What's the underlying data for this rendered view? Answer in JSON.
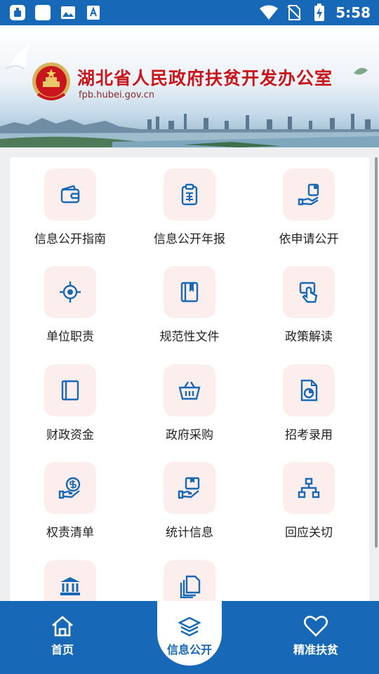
{
  "status_bar": {
    "time": "5:58",
    "left_icons": [
      "app-notification-icon",
      "blank-square-icon",
      "image-icon",
      "text-a-icon"
    ],
    "right_icons": [
      "wifi-icon",
      "no-sim-icon",
      "battery-charging-icon"
    ]
  },
  "banner": {
    "title": "湖北省人民政府扶贫开发办公室",
    "url": "fpb.hubei.gov.cn",
    "emblem": "national-emblem-icon"
  },
  "grid": {
    "items": [
      {
        "label": "信息公开指南",
        "icon": "wallet-icon"
      },
      {
        "label": "信息公开年报",
        "icon": "clipboard-year-icon"
      },
      {
        "label": "依申请公开",
        "icon": "hand-document-icon"
      },
      {
        "label": "单位职责",
        "icon": "target-icon"
      },
      {
        "label": "规范性文件",
        "icon": "bookmark-book-icon"
      },
      {
        "label": "政策解读",
        "icon": "touch-pointer-icon"
      },
      {
        "label": "财政资金",
        "icon": "notebook-icon"
      },
      {
        "label": "政府采购",
        "icon": "shopping-basket-icon"
      },
      {
        "label": "招考录用",
        "icon": "document-chart-icon"
      },
      {
        "label": "权责清单",
        "icon": "hand-coin-icon"
      },
      {
        "label": "统计信息",
        "icon": "hand-box-icon"
      },
      {
        "label": "回应关切",
        "icon": "org-chart-icon"
      },
      {
        "label": "",
        "icon": "government-building-icon"
      },
      {
        "label": "",
        "icon": "copy-documents-icon"
      }
    ]
  },
  "bottom_nav": {
    "items": [
      {
        "label": "首页",
        "icon": "home-icon"
      },
      {
        "label": "信息公开",
        "icon": "layers-icon"
      },
      {
        "label": "精准扶贫",
        "icon": "heart-icon"
      }
    ],
    "active_index": 1
  },
  "colors": {
    "primary": "#1769b8",
    "icon_bg": "#fdeeee",
    "banner_title": "#c9161c"
  }
}
